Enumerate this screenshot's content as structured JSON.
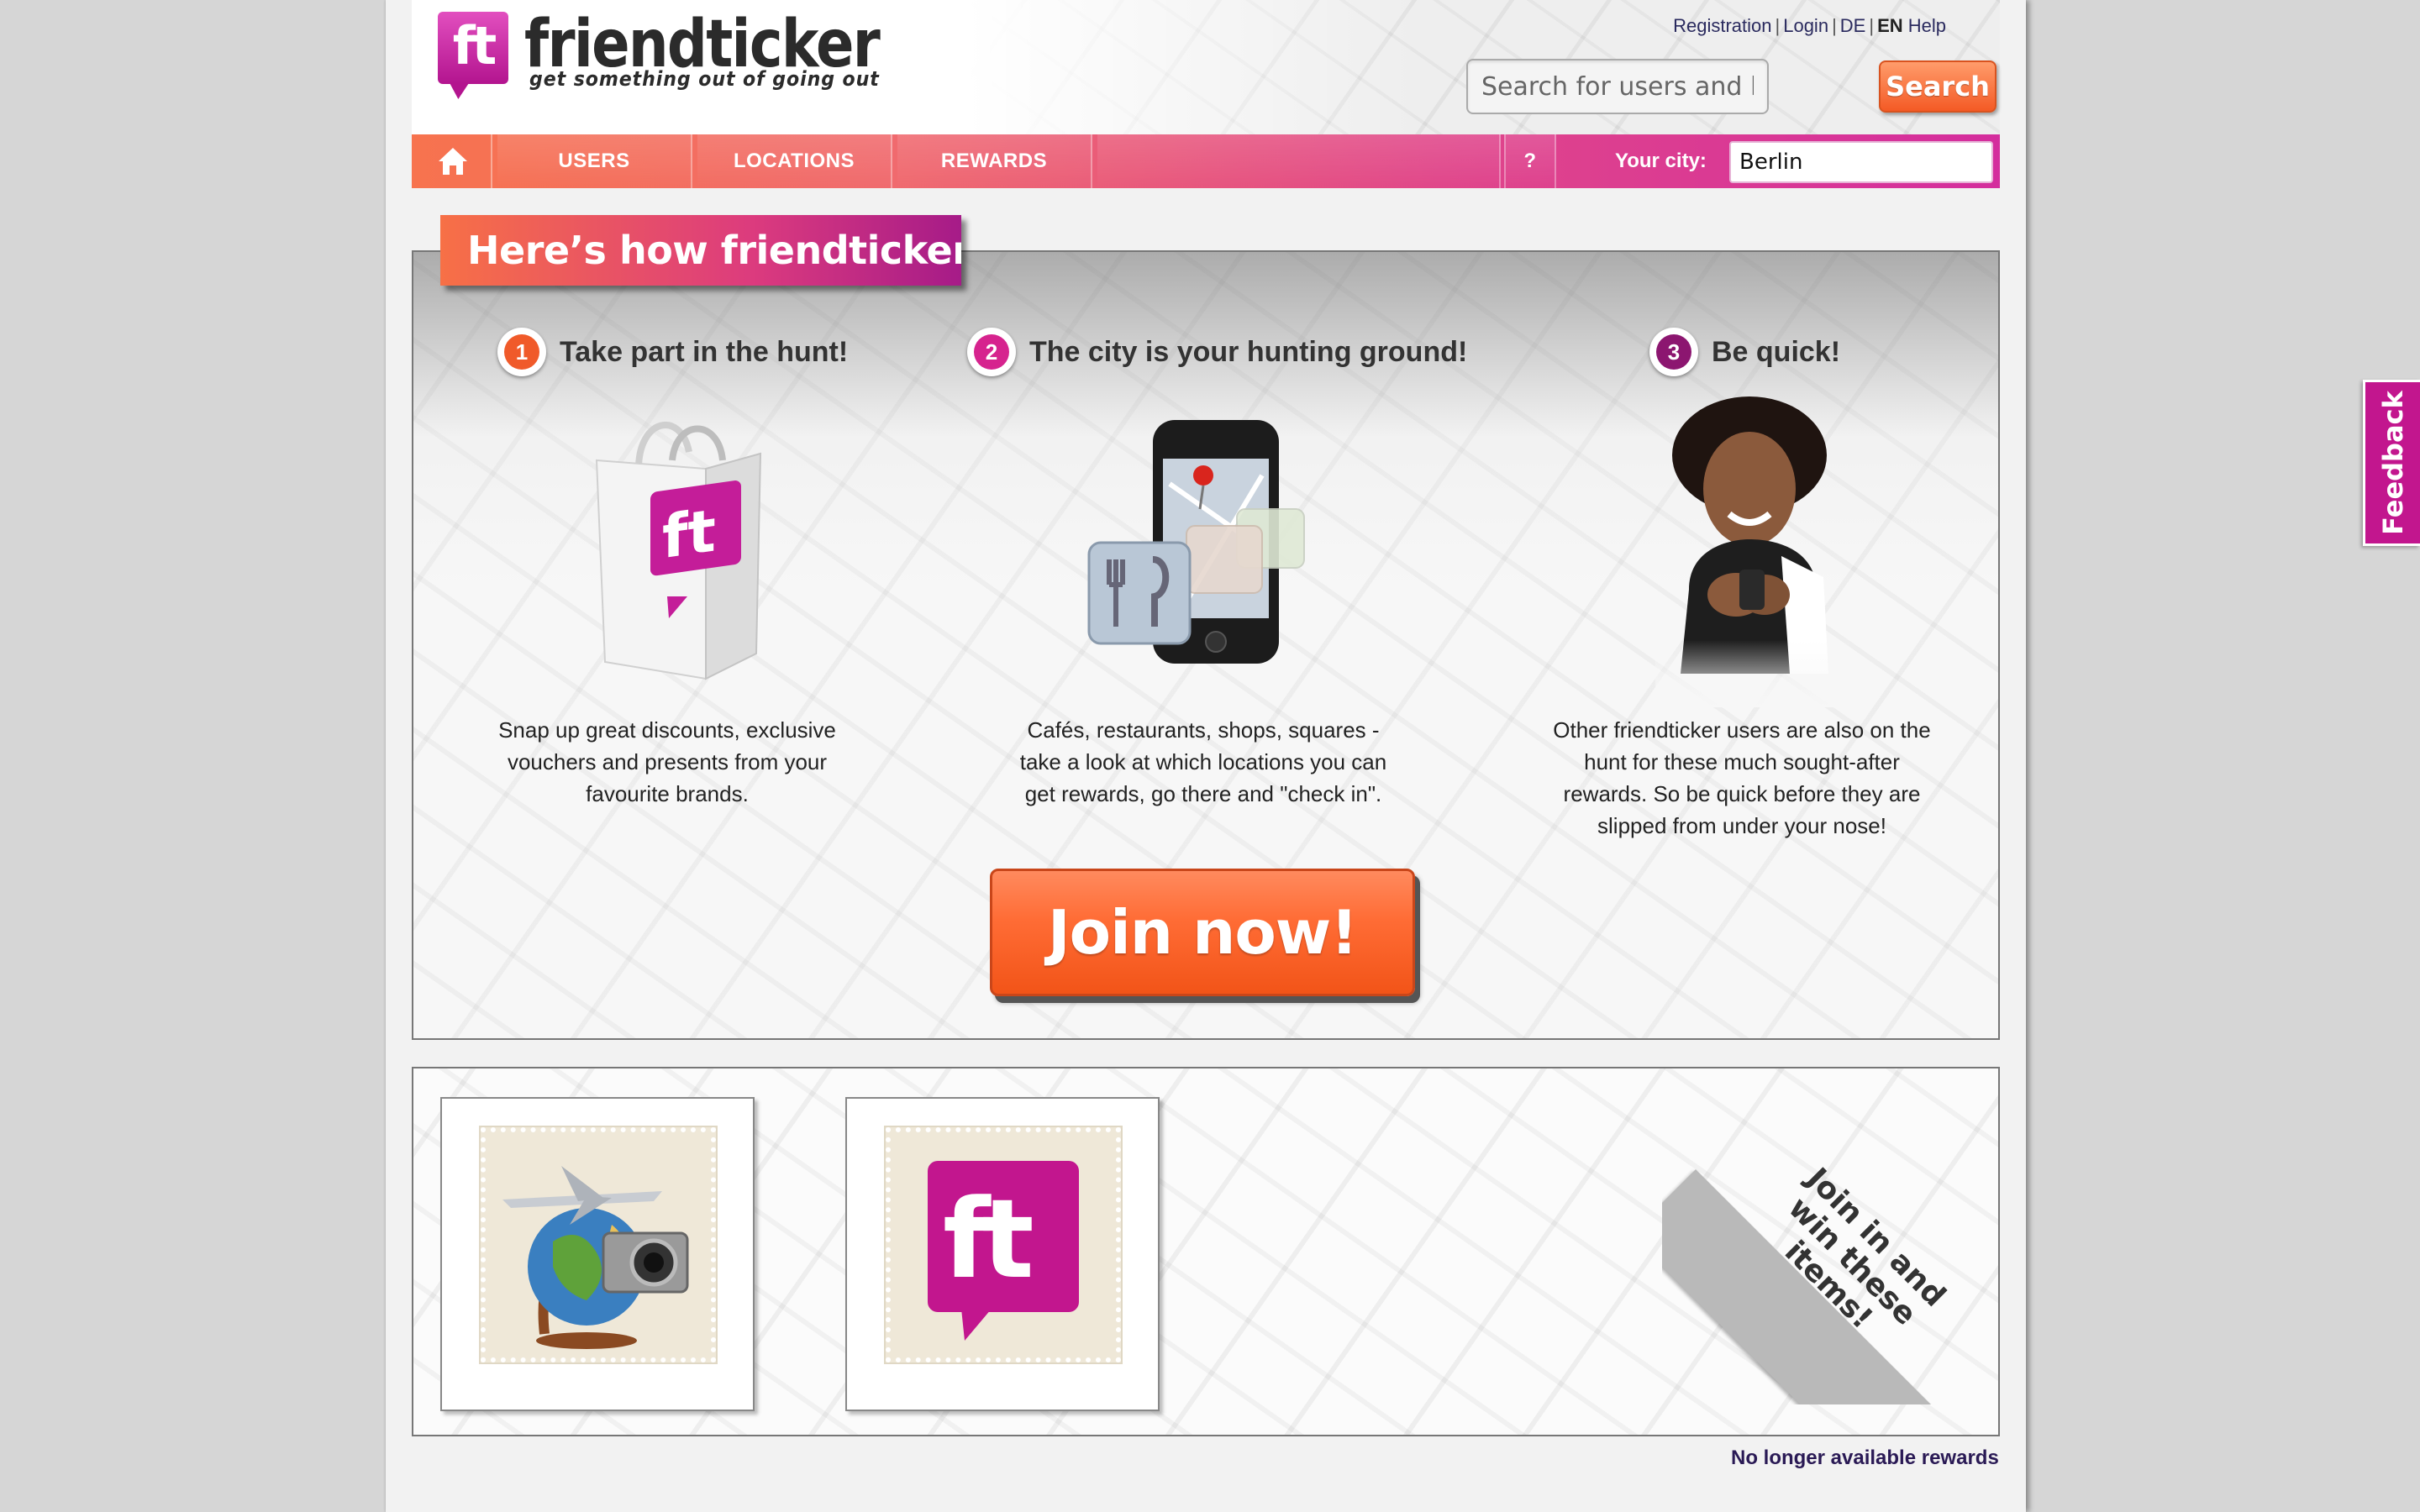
{
  "header": {
    "logo_letters": "ft",
    "logo_name": "friendticker",
    "tagline": "get something out of going out",
    "links": {
      "registration": "Registration",
      "login": "Login",
      "lang_de": "DE",
      "lang_en": "EN",
      "help": "Help",
      "sep": "|"
    },
    "search": {
      "placeholder": "Search for users and locations",
      "button_label": "Search"
    }
  },
  "nav": {
    "items": [
      {
        "label": "USERS"
      },
      {
        "label": "LOCATIONS"
      },
      {
        "label": "REWARDS"
      }
    ],
    "help_label": "?",
    "city_label": "Your city:",
    "city_value": "Berlin"
  },
  "how": {
    "title": "Here’s how friendticker works",
    "steps": [
      {
        "number": "1",
        "title": "Take part in the hunt!",
        "text": "Snap up great discounts, exclusive vouchers and presents from your favourite brands."
      },
      {
        "number": "2",
        "title": "The city is your hunting ground!",
        "text": "Cafés, restaurants, shops, squares - take a look at which locations you can get rewards, go there and \"check in\"."
      },
      {
        "number": "3",
        "title": "Be quick!",
        "text": "Other friendticker users are also on the hunt for these much sought-after rewards. So be quick before they are slipped from under your nose!"
      }
    ],
    "join_label": "Join now!"
  },
  "rewards": {
    "ribbon_text": "Join in and win these items!",
    "no_longer_label": "No longer available rewards"
  },
  "feedback_label": "Feedback",
  "colors": {
    "brand_magenta": "#c2168e",
    "brand_orange": "#f45a25"
  }
}
